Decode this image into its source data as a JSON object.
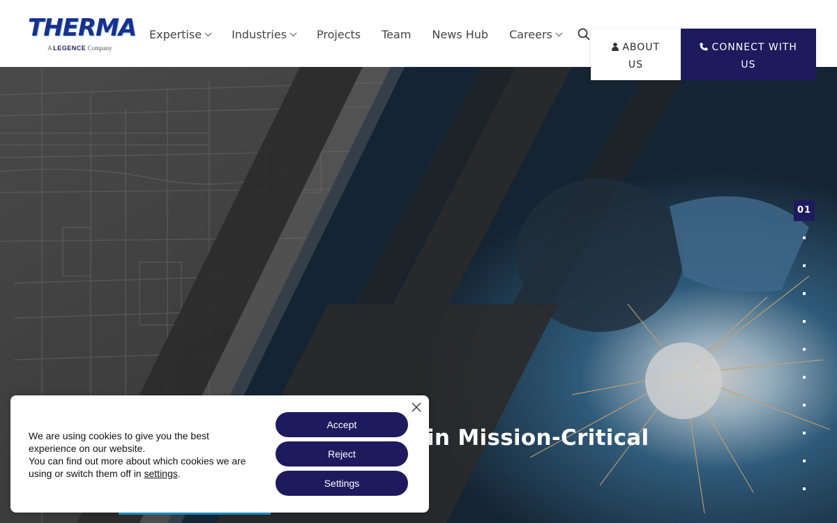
{
  "brand": {
    "logo_text": "THERMA",
    "tagline_prefix": "A",
    "tagline_brand": "LEGENCE",
    "tagline_suffix": "Company"
  },
  "nav": {
    "items": [
      {
        "label": "Expertise",
        "dropdown": true
      },
      {
        "label": "Industries",
        "dropdown": true
      },
      {
        "label": "Projects",
        "dropdown": false
      },
      {
        "label": "Team",
        "dropdown": false
      },
      {
        "label": "News Hub",
        "dropdown": false
      },
      {
        "label": "Careers",
        "dropdown": true
      }
    ],
    "search_icon": "search-icon"
  },
  "header_buttons": {
    "about_icon": "user-icon",
    "about_line1": "ABOUT",
    "about_line2": "US",
    "connect_icon": "phone-icon",
    "connect_line1": "CONNECT WITH",
    "connect_line2": "US"
  },
  "hero": {
    "title_visible": "in Mission-Critical",
    "slide_current": "01",
    "slide_count": 11
  },
  "cookie": {
    "line1": "We are using cookies to give you the best experience on our website.",
    "line2_prefix": "You can find out more about which cookies we are using or switch them off in",
    "settings_link": "settings",
    "line2_suffix": ".",
    "accept_label": "Accept",
    "reject_label": "Reject",
    "settings_label": "Settings"
  },
  "colors": {
    "brand_navy": "#1e1a5e",
    "logo_blue": "#1a2f8c",
    "accent_cyan": "#1e9fd8"
  }
}
